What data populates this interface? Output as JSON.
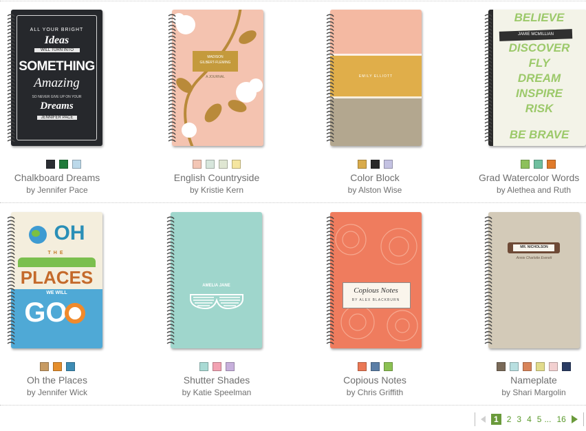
{
  "products": [
    {
      "title": "Chalkboard Dreams",
      "designer": "by Jennifer Pace",
      "swatches": [
        "#2b2e33",
        "#1f7a3a",
        "#bcd9ea"
      ],
      "cover": {
        "lines": [
          "ALL YOUR BRIGHT",
          "Ideas",
          "WILL TURN INTO",
          "SOMETHING",
          "Amazing",
          "SO NEVER GIVE UP ON YOUR",
          "Dreams",
          "JENNIFER PACE"
        ]
      }
    },
    {
      "title": "English Countryside",
      "designer": "by Kristie Kern",
      "swatches": [
        "#f3c6b5",
        "#d7e6dc",
        "#dfe6d2",
        "#f5e6a0"
      ],
      "cover": {
        "lines": [
          "MADISON",
          "GILBERT-FLEMING",
          "A JOURNAL"
        ]
      }
    },
    {
      "title": "Color Block",
      "designer": "by Alston Wise",
      "swatches": [
        "#d9ab4b",
        "#2a2a2a",
        "#c4c2e2"
      ],
      "cover": {
        "lines": [
          "EMILY ELLIOTT"
        ]
      }
    },
    {
      "title": "Grad Watercolor Words",
      "designer": "by Alethea and Ruth",
      "swatches": [
        "#8dc05b",
        "#6fbf9f",
        "#e07a2a"
      ],
      "cover": {
        "lines": [
          "JAMIE MCMILLIAN",
          "BELIEVE",
          "DISCOVER",
          "FLY",
          "DREAM",
          "INSPIRE",
          "RISK",
          "BE BRAVE"
        ]
      }
    },
    {
      "title": "Oh the Places",
      "designer": "by Jennifer Wick",
      "swatches": [
        "#c79b63",
        "#e58e2c",
        "#3d8cb4"
      ],
      "cover": {
        "lines": [
          "OH",
          "THE",
          "PLACES",
          "WE WILL",
          "GO"
        ]
      }
    },
    {
      "title": "Shutter Shades",
      "designer": "by Katie Speelman",
      "swatches": [
        "#a9dad4",
        "#f2a2b2",
        "#c7b0dc"
      ],
      "cover": {
        "lines": [
          "AMELIA JANE"
        ]
      }
    },
    {
      "title": "Copious Notes",
      "designer": "by Chris Griffith",
      "swatches": [
        "#ea7855",
        "#5b7ea6",
        "#8cc153"
      ],
      "cover": {
        "lines": [
          "Copious Notes",
          "BY ALEX BLACKBURN"
        ]
      }
    },
    {
      "title": "Nameplate",
      "designer": "by Shari Margolin",
      "swatches": [
        "#7a6a58",
        "#b8dfe0",
        "#d8845a",
        "#e2dc8c",
        "#f2d0d0",
        "#2a3b63"
      ],
      "cover": {
        "lines": [
          "MR. NICHOLSON",
          "Annie Charlotte Everett"
        ]
      }
    }
  ],
  "pagination": {
    "current": "1",
    "pages": [
      "2",
      "3",
      "4",
      "5"
    ],
    "ellipsis": "...",
    "last": "16"
  }
}
